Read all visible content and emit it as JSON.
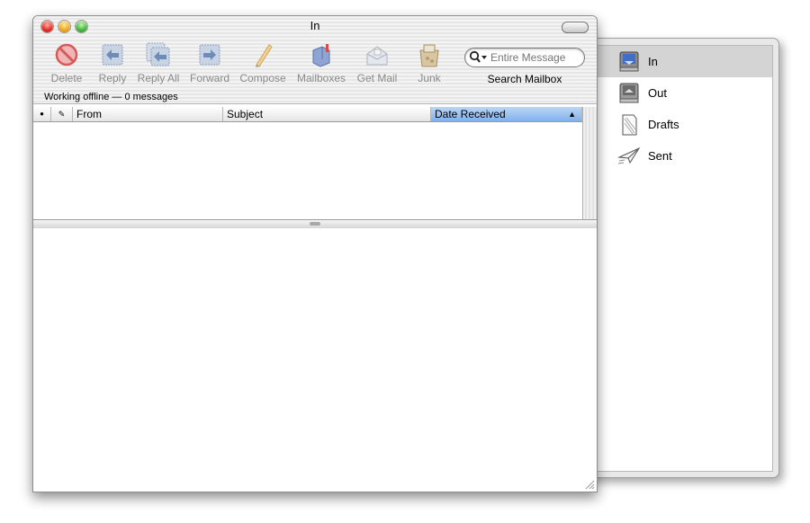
{
  "window": {
    "title": "In",
    "status": "Working offline — 0 messages"
  },
  "toolbar": {
    "buttons": [
      {
        "label": "Delete",
        "icon": "delete-icon"
      },
      {
        "label": "Reply",
        "icon": "reply-icon"
      },
      {
        "label": "Reply All",
        "icon": "reply-all-icon"
      },
      {
        "label": "Forward",
        "icon": "forward-icon"
      },
      {
        "label": "Compose",
        "icon": "compose-icon"
      },
      {
        "label": "Mailboxes",
        "icon": "mailboxes-icon"
      },
      {
        "label": "Get Mail",
        "icon": "get-mail-icon"
      },
      {
        "label": "Junk",
        "icon": "junk-icon"
      }
    ],
    "search": {
      "placeholder": "Entire Message",
      "caption": "Search Mailbox"
    }
  },
  "columns": {
    "read": "●",
    "flag": "✎",
    "from": "From",
    "subject": "Subject",
    "date": "Date Received",
    "sort_indicator": "▲"
  },
  "mailboxes": [
    {
      "label": "In",
      "icon": "inbox-icon",
      "selected": true
    },
    {
      "label": "Out",
      "icon": "outbox-icon",
      "selected": false
    },
    {
      "label": "Drafts",
      "icon": "drafts-icon",
      "selected": false
    },
    {
      "label": "Sent",
      "icon": "sent-icon",
      "selected": false
    }
  ],
  "colors": {
    "sort_header": "#7fb1ec",
    "selected_row": "#d4d4d4",
    "toolbar_text": "#8a8a8a"
  }
}
